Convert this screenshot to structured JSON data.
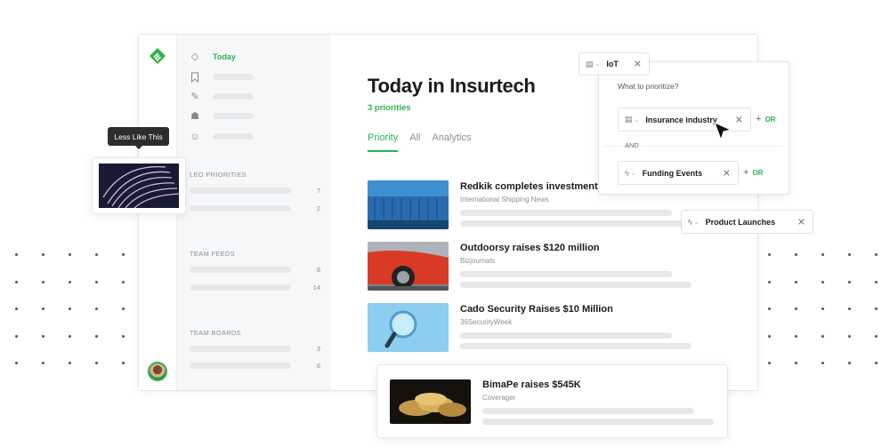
{
  "app": {
    "logo": "feedly-logo-icon",
    "brand_color": "#2bb24c"
  },
  "sidebar": {
    "nav": [
      {
        "label": "Today",
        "icon": "diamond-icon"
      },
      {
        "label": "",
        "icon": "bookmark-icon"
      },
      {
        "label": "",
        "icon": "pen-icon"
      },
      {
        "label": "",
        "icon": "robot-icon"
      },
      {
        "label": "",
        "icon": "smile-icon"
      }
    ],
    "sections": [
      {
        "title": "LEO PRIORITIES",
        "counts": [
          "7",
          "2"
        ]
      },
      {
        "title": "TEAM FEEDS",
        "counts": [
          "8",
          "14"
        ]
      },
      {
        "title": "TEAM BOARDS",
        "counts": [
          "3",
          "6"
        ]
      }
    ]
  },
  "main": {
    "title": "Today in Insurtech",
    "priorities_count": "3 priorities",
    "tabs": [
      {
        "label": "Priority",
        "active": true
      },
      {
        "label": "All",
        "active": false
      },
      {
        "label": "Analytics",
        "active": false
      }
    ],
    "articles": [
      {
        "title": "Redkik completes investment",
        "source": "International Shipping News"
      },
      {
        "title": "Outdoorsy raises $120 million",
        "source": "Bizjournals"
      },
      {
        "title": "Cado Security Raises $10 Million",
        "source": "36SecurityWeek"
      }
    ]
  },
  "floating_article": {
    "title": "BimaPe raises $545K",
    "source": "Coverager"
  },
  "tooltip": {
    "text": "Less Like This"
  },
  "prioritize_panel": {
    "iot_chip": "IoT",
    "question": "What to prioritize?",
    "and_label": "AND",
    "or_label": "OR",
    "filters": [
      {
        "label": "Insurance industry",
        "icon": "industry-icon"
      },
      {
        "label": "Funding Events",
        "icon": "lightning-icon"
      }
    ],
    "extra_chip": "Product Launches"
  }
}
